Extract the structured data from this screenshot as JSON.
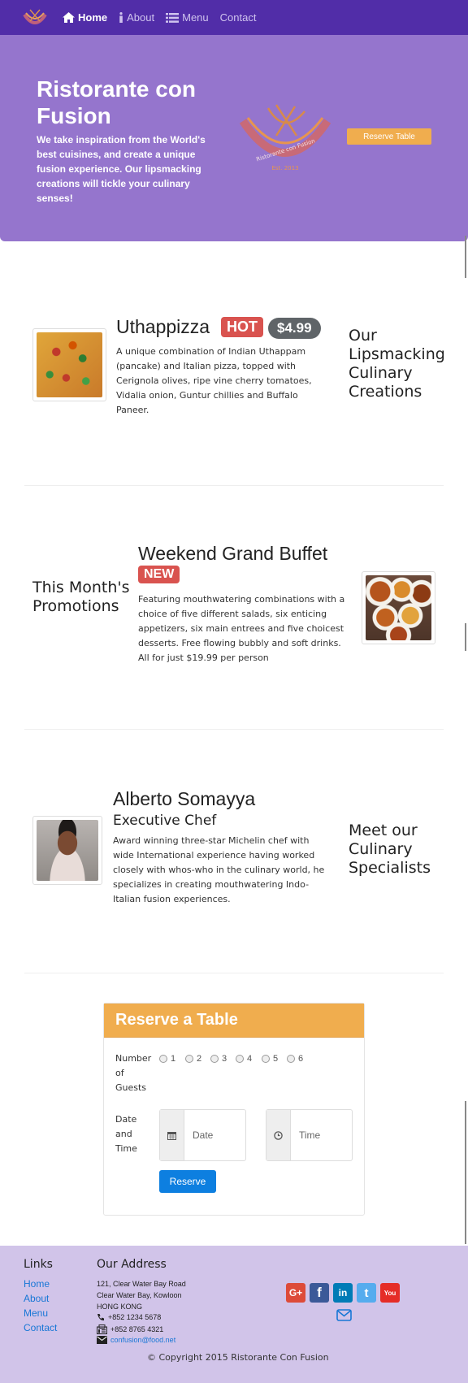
{
  "nav": {
    "items": [
      {
        "label": "Home",
        "icon": "home-icon",
        "active": true
      },
      {
        "label": "About",
        "icon": "info-icon",
        "active": false
      },
      {
        "label": "Menu",
        "icon": "list-icon",
        "active": false
      },
      {
        "label": "Contact",
        "icon": "",
        "active": false
      }
    ]
  },
  "jumbotron": {
    "title": "Ristorante con Fusion",
    "text": "We take inspiration from the World's best cuisines, and create a unique fusion experience. Our lipsmacking creations will tickle your culinary senses!",
    "logo_text": "Ristorante con Fusion",
    "logo_est": "Est. 2013",
    "reserve_button": "Reserve Table"
  },
  "dish": {
    "name": "Uthappizza",
    "badge": "HOT",
    "price": "$4.99",
    "description": "A unique combination of Indian Uthappam (pancake) and Italian pizza, topped with Cerignola olives, ripe vine cherry tomatoes, Vidalia onion, Guntur chillies and Buffalo Paneer.",
    "side_heading": "Our Lipsmacking Culinary Creations"
  },
  "promotion": {
    "name": "Weekend Grand Buffet",
    "badge": "NEW",
    "description": "Featuring mouthwatering combinations with a choice of five different salads, six enticing appetizers, six main entrees and five choicest desserts. Free flowing bubbly and soft drinks. All for just $19.99 per person",
    "side_heading": "This Month's Promotions"
  },
  "leader": {
    "name": "Alberto Somayya",
    "designation": "Executive Chef",
    "description": "Award winning three-star Michelin chef with wide International experience having worked closely with whos-who in the culinary world, he specializes in creating mouthwatering Indo-Italian fusion experiences.",
    "side_heading": "Meet our Culinary Specialists"
  },
  "reservation": {
    "title": "Reserve a Table",
    "guests_label": "Number of Guests",
    "guest_options": [
      "1",
      "2",
      "3",
      "4",
      "5",
      "6"
    ],
    "datetime_label": "Date and Time",
    "date_placeholder": "Date",
    "time_placeholder": "Time",
    "submit": "Reserve"
  },
  "footer": {
    "links_heading": "Links",
    "links": [
      "Home",
      "About",
      "Menu",
      "Contact"
    ],
    "address_heading": "Our Address",
    "address_lines": [
      "121, Clear Water Bay Road",
      "Clear Water Bay, Kowloon",
      "HONG KONG"
    ],
    "phone": "+852 1234 5678",
    "fax": "+852 8765 4321",
    "email": "confusion@food.net",
    "social": [
      {
        "name": "google-plus",
        "color": "#dd4b39",
        "glyph": "G+"
      },
      {
        "name": "facebook",
        "color": "#3b5998",
        "glyph": "f"
      },
      {
        "name": "linkedin",
        "color": "#007bb6",
        "glyph": "in"
      },
      {
        "name": "twitter",
        "color": "#55acee",
        "glyph": "t"
      },
      {
        "name": "youtube",
        "color": "#e52d27",
        "glyph": "You"
      }
    ],
    "copyright": "© Copyright 2015 Ristorante Con Fusion"
  },
  "colors": {
    "navbar": "#512da8",
    "jumbotron": "#9575cd",
    "footer": "#d1c4e9",
    "warning": "#f0ad4e",
    "danger": "#d9534f",
    "primary": "#0d7fe0"
  }
}
